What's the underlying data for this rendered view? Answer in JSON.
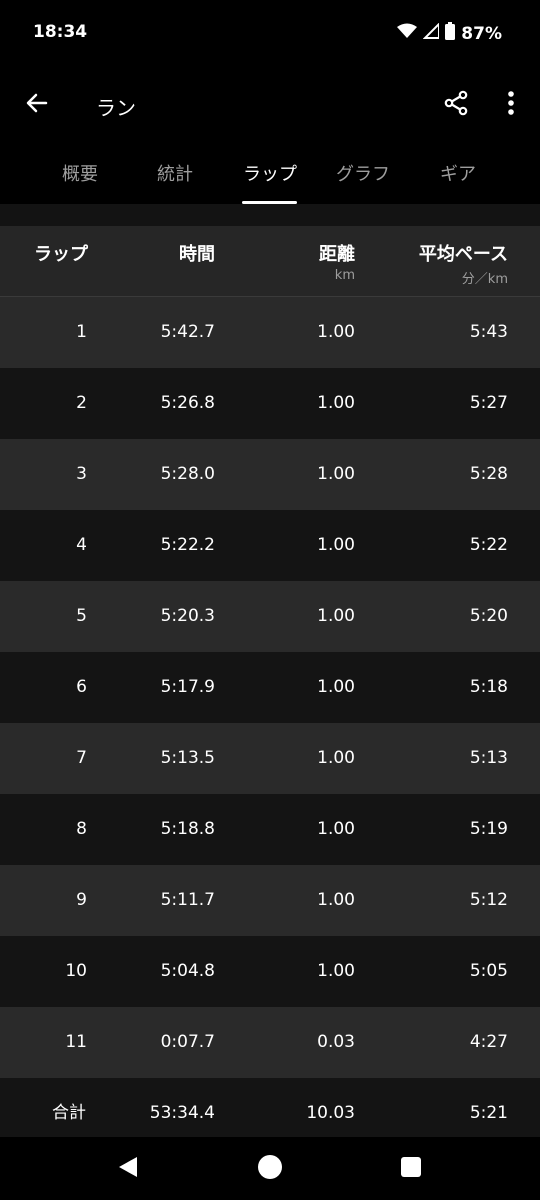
{
  "status_bar": {
    "time": "18:34",
    "battery": "87%",
    "icons": [
      "wifi-icon",
      "signal-icon",
      "battery-icon"
    ]
  },
  "app_bar": {
    "title": "ラン",
    "icons": [
      "back-arrow-icon",
      "share-icon",
      "more-vert-icon"
    ]
  },
  "tabs": [
    {
      "label": "概要",
      "active": false
    },
    {
      "label": "統計",
      "active": false
    },
    {
      "label": "ラップ",
      "active": true
    },
    {
      "label": "グラフ",
      "active": false
    },
    {
      "label": "ギア",
      "active": false
    }
  ],
  "table": {
    "headers": {
      "lap": "ラップ",
      "time": "時間",
      "distance": "距離",
      "distance_unit": "km",
      "pace": "平均ペース",
      "pace_unit": "分／km"
    },
    "rows": [
      {
        "lap": "1",
        "time": "5:42.7",
        "distance": "1.00",
        "pace": "5:43"
      },
      {
        "lap": "2",
        "time": "5:26.8",
        "distance": "1.00",
        "pace": "5:27"
      },
      {
        "lap": "3",
        "time": "5:28.0",
        "distance": "1.00",
        "pace": "5:28"
      },
      {
        "lap": "4",
        "time": "5:22.2",
        "distance": "1.00",
        "pace": "5:22"
      },
      {
        "lap": "5",
        "time": "5:20.3",
        "distance": "1.00",
        "pace": "5:20"
      },
      {
        "lap": "6",
        "time": "5:17.9",
        "distance": "1.00",
        "pace": "5:18"
      },
      {
        "lap": "7",
        "time": "5:13.5",
        "distance": "1.00",
        "pace": "5:13"
      },
      {
        "lap": "8",
        "time": "5:18.8",
        "distance": "1.00",
        "pace": "5:19"
      },
      {
        "lap": "9",
        "time": "5:11.7",
        "distance": "1.00",
        "pace": "5:12"
      },
      {
        "lap": "10",
        "time": "5:04.8",
        "distance": "1.00",
        "pace": "5:05"
      },
      {
        "lap": "11",
        "time": "0:07.7",
        "distance": "0.03",
        "pace": "4:27"
      }
    ],
    "total": {
      "lap": "合計",
      "time": "53:34.4",
      "distance": "10.03",
      "pace": "5:21"
    }
  },
  "nav_bar": {
    "icons": [
      "nav-back-icon",
      "nav-home-icon",
      "nav-recents-icon"
    ]
  },
  "colors": {
    "background": "#000000",
    "row_light": "#2a2a2a",
    "row_dark": "#141414",
    "header_bg": "#262626",
    "muted_text": "#9e9e9e",
    "text": "#ffffff"
  }
}
